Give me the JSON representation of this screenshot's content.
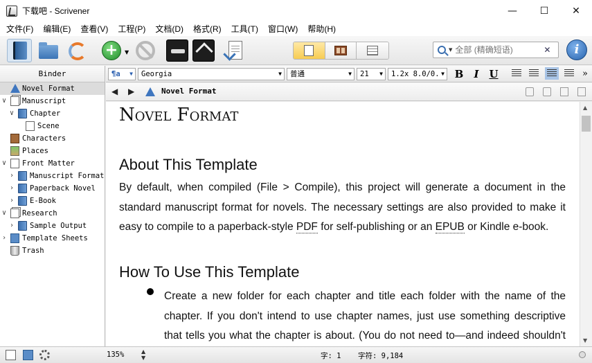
{
  "window": {
    "title": "下载吧 - Scrivener",
    "controls": {
      "minimize": "—",
      "maximize": "☐",
      "close": "✕"
    }
  },
  "menu": [
    "文件(F)",
    "编辑(E)",
    "查看(V)",
    "工程(P)",
    "文档(D)",
    "格式(R)",
    "工具(T)",
    "窗口(W)",
    "帮助(H)"
  ],
  "toolbar": {
    "add_symbol": "+",
    "add_dropdown": "▼",
    "search": {
      "scope_arrow": "▼",
      "placeholder": "全部 (精确短语)",
      "clear": "✕"
    },
    "info": "i"
  },
  "binder": {
    "header": "Binder",
    "items": [
      {
        "label": "Novel Format",
        "depth": 0,
        "icon": "warning-doc-icon",
        "arrow": "",
        "selected": true
      },
      {
        "label": "Manuscript",
        "depth": 0,
        "icon": "manuscript-icon",
        "arrow": "∨"
      },
      {
        "label": "Chapter",
        "depth": 1,
        "icon": "folder-icon",
        "arrow": "∨"
      },
      {
        "label": "Scene",
        "depth": 2,
        "icon": "document-icon",
        "arrow": ""
      },
      {
        "label": "Characters",
        "depth": 0,
        "icon": "character-icon",
        "arrow": ""
      },
      {
        "label": "Places",
        "depth": 0,
        "icon": "places-icon",
        "arrow": ""
      },
      {
        "label": "Front Matter",
        "depth": 0,
        "icon": "front-matter-icon",
        "arrow": "∨"
      },
      {
        "label": "Manuscript Format",
        "depth": 1,
        "icon": "folder-icon",
        "arrow": "›"
      },
      {
        "label": "Paperback Novel",
        "depth": 1,
        "icon": "folder-icon",
        "arrow": "›"
      },
      {
        "label": "E-Book",
        "depth": 1,
        "icon": "folder-icon",
        "arrow": "›"
      },
      {
        "label": "Research",
        "depth": 0,
        "icon": "research-icon",
        "arrow": "∨"
      },
      {
        "label": "Sample Output",
        "depth": 1,
        "icon": "folder-icon",
        "arrow": "›"
      },
      {
        "label": "Template Sheets",
        "depth": 0,
        "icon": "template-sheets-icon",
        "arrow": "›"
      },
      {
        "label": "Trash",
        "depth": 0,
        "icon": "trash-icon",
        "arrow": ""
      }
    ]
  },
  "format_bar": {
    "paragraph_style_icon": "¶a",
    "font": "Georgia",
    "style": "普通",
    "size": "21",
    "spacing": "1.2x 8.0/0.",
    "bold": "B",
    "italic": "I",
    "underline": "U",
    "overflow": "»"
  },
  "editor_header": {
    "back": "◀",
    "forward": "▶",
    "title": "Novel Format"
  },
  "document": {
    "title": "Novel Format",
    "h_about": "About This Template",
    "p_about_1": "By default, when compiled (File > Compile), this project will generate a document in the standard manuscript format for novels. The necessary settings are also provided to make it easy to compile to a paperback-style ",
    "pdf": "PDF",
    "p_about_2": " for self-publishing or an ",
    "epub": "EPUB",
    "p_about_3": " or Kindle e-book.",
    "h_howto": "How To Use This Template",
    "bullet_1": "Create a new folder for each chapter and title each folder with the name of the chapter. If you don't intend to use chapter names, just use something descriptive that tells you what the chapter is about. (You do not need to—and indeed shouldn't—title"
  },
  "footer": {
    "zoom": "135%",
    "zoom_up": "▲",
    "zoom_down": "▼",
    "char_label": "字: 1",
    "word_label": "字符: 9,184"
  }
}
